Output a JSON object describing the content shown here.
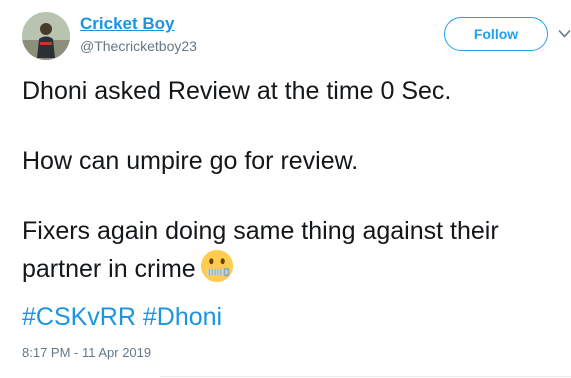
{
  "author": {
    "display_name": "Cricket Boy",
    "handle": "@Thecricketboy23",
    "avatar_icon": "avatar-person-icon"
  },
  "actions": {
    "follow_label": "Follow",
    "more_icon": "chevron-down-icon"
  },
  "tweet": {
    "paragraphs": [
      "Dhoni asked Review at the time 0 Sec.",
      "How can umpire go for review.",
      "Fixers again doing same thing against their partner in crime"
    ],
    "emoji": "zipper-mouth-face-icon",
    "hashtags": [
      "#CSKvRR",
      "#Dhoni"
    ],
    "timestamp": "8:17 PM - 11 Apr 2019"
  },
  "colors": {
    "link": "#1b95e0",
    "follow": "#1da1f2",
    "secondary_text": "#657786",
    "text": "#14171a"
  }
}
